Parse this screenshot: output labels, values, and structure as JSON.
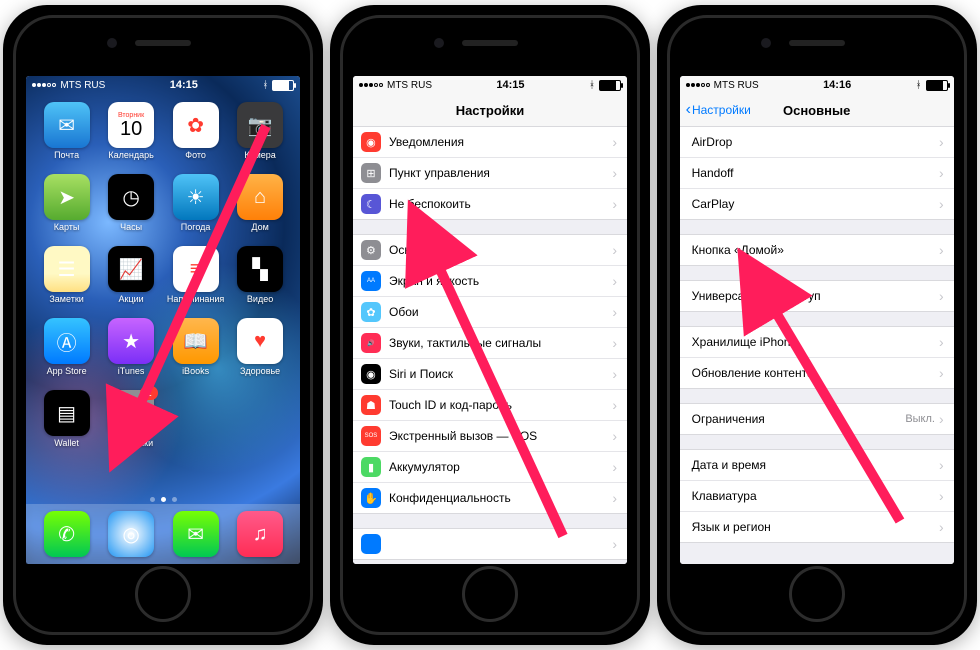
{
  "status": {
    "carrier": "MTS RUS",
    "time1": "14:15",
    "time2": "14:15",
    "time3": "14:16"
  },
  "home": {
    "date_day": "Вторник",
    "date_num": "10",
    "apps": [
      {
        "label": "Почта",
        "color": "linear-gradient(#4fc3f7,#1976d2)",
        "glyph": "✉"
      },
      {
        "label": "Календарь",
        "color": "#fff",
        "glyph": ""
      },
      {
        "label": "Фото",
        "color": "#fff",
        "glyph": "✿"
      },
      {
        "label": "Камера",
        "color": "#3a3a3c",
        "glyph": "📷"
      },
      {
        "label": "Карты",
        "color": "linear-gradient(#a8e063,#56ab2f)",
        "glyph": "➤"
      },
      {
        "label": "Часы",
        "color": "#000",
        "glyph": "◷"
      },
      {
        "label": "Погода",
        "color": "linear-gradient(#4fc3f7,#0277bd)",
        "glyph": "☀"
      },
      {
        "label": "Дом",
        "color": "linear-gradient(#ffb347,#ff8008)",
        "glyph": "⌂"
      },
      {
        "label": "Заметки",
        "color": "linear-gradient(#fff9c4 60%,#ffe082)",
        "glyph": "☰"
      },
      {
        "label": "Акции",
        "color": "#000",
        "glyph": "📈"
      },
      {
        "label": "Напоминания",
        "color": "#fff",
        "glyph": "≡"
      },
      {
        "label": "Видео",
        "color": "#000",
        "glyph": "▚"
      },
      {
        "label": "App Store",
        "color": "linear-gradient(#35c3ff,#007aff)",
        "glyph": "Ⓐ"
      },
      {
        "label": "iTunes",
        "color": "linear-gradient(#c764ff,#7b2ff7)",
        "glyph": "★"
      },
      {
        "label": "iBooks",
        "color": "linear-gradient(#ffb74d,#ff9800)",
        "glyph": "📖"
      },
      {
        "label": "Здоровье",
        "color": "#fff",
        "glyph": "♥"
      },
      {
        "label": "Wallet",
        "color": "#000",
        "glyph": "▤"
      },
      {
        "label": "Настройки",
        "color": "#8e8e93",
        "glyph": "⚙",
        "badge": "1"
      }
    ],
    "dock": [
      {
        "label": "Phone",
        "color": "linear-gradient(#76ff03,#00c853)",
        "glyph": "✆"
      },
      {
        "label": "Safari",
        "color": "radial-gradient(#fff,#2196f3)",
        "glyph": "◎"
      },
      {
        "label": "Messages",
        "color": "linear-gradient(#76ff03,#00c853)",
        "glyph": "✉"
      },
      {
        "label": "Music",
        "color": "linear-gradient(#ff5a8a,#ff2d55)",
        "glyph": "♫"
      }
    ]
  },
  "settings": {
    "title": "Настройки",
    "groups": [
      [
        {
          "label": "Уведомления",
          "color": "#ff3b30",
          "glyph": "◉"
        },
        {
          "label": "Пункт управления",
          "color": "#8e8e93",
          "glyph": "⊞"
        },
        {
          "label": "Не беспокоить",
          "color": "#5856d6",
          "glyph": "☾"
        }
      ],
      [
        {
          "label": "Основные",
          "color": "#8e8e93",
          "glyph": "⚙"
        },
        {
          "label": "Экран и яркость",
          "color": "#007aff",
          "glyph": "AA"
        },
        {
          "label": "Обои",
          "color": "#54c7fc",
          "glyph": "✿"
        },
        {
          "label": "Звуки, тактильные сигналы",
          "color": "#ff2d55",
          "glyph": "🔊"
        },
        {
          "label": "Siri и Поиск",
          "color": "#000",
          "glyph": "◉"
        },
        {
          "label": "Touch ID и код-пароль",
          "color": "#ff3b30",
          "glyph": "☗"
        },
        {
          "label": "Экстренный вызов — SOS",
          "color": "#ff3b30",
          "glyph": "SOS"
        },
        {
          "label": "Аккумулятор",
          "color": "#4cd964",
          "glyph": "▮"
        },
        {
          "label": "Конфиденциальность",
          "color": "#007aff",
          "glyph": "✋"
        }
      ],
      [
        {
          "label": "",
          "color": "#007aff",
          "glyph": ""
        }
      ]
    ]
  },
  "general": {
    "back": "Настройки",
    "title": "Основные",
    "groups": [
      [
        {
          "label": "AirDrop"
        },
        {
          "label": "Handoff"
        },
        {
          "label": "CarPlay"
        }
      ],
      [
        {
          "label": "Кнопка «Домой»"
        }
      ],
      [
        {
          "label": "Универсальный доступ"
        }
      ],
      [
        {
          "label": "Хранилище iPhone"
        },
        {
          "label": "Обновление контента"
        }
      ],
      [
        {
          "label": "Ограничения",
          "value": "Выкл."
        }
      ],
      [
        {
          "label": "Дата и время"
        },
        {
          "label": "Клавиатура"
        },
        {
          "label": "Язык и регион"
        }
      ]
    ]
  }
}
